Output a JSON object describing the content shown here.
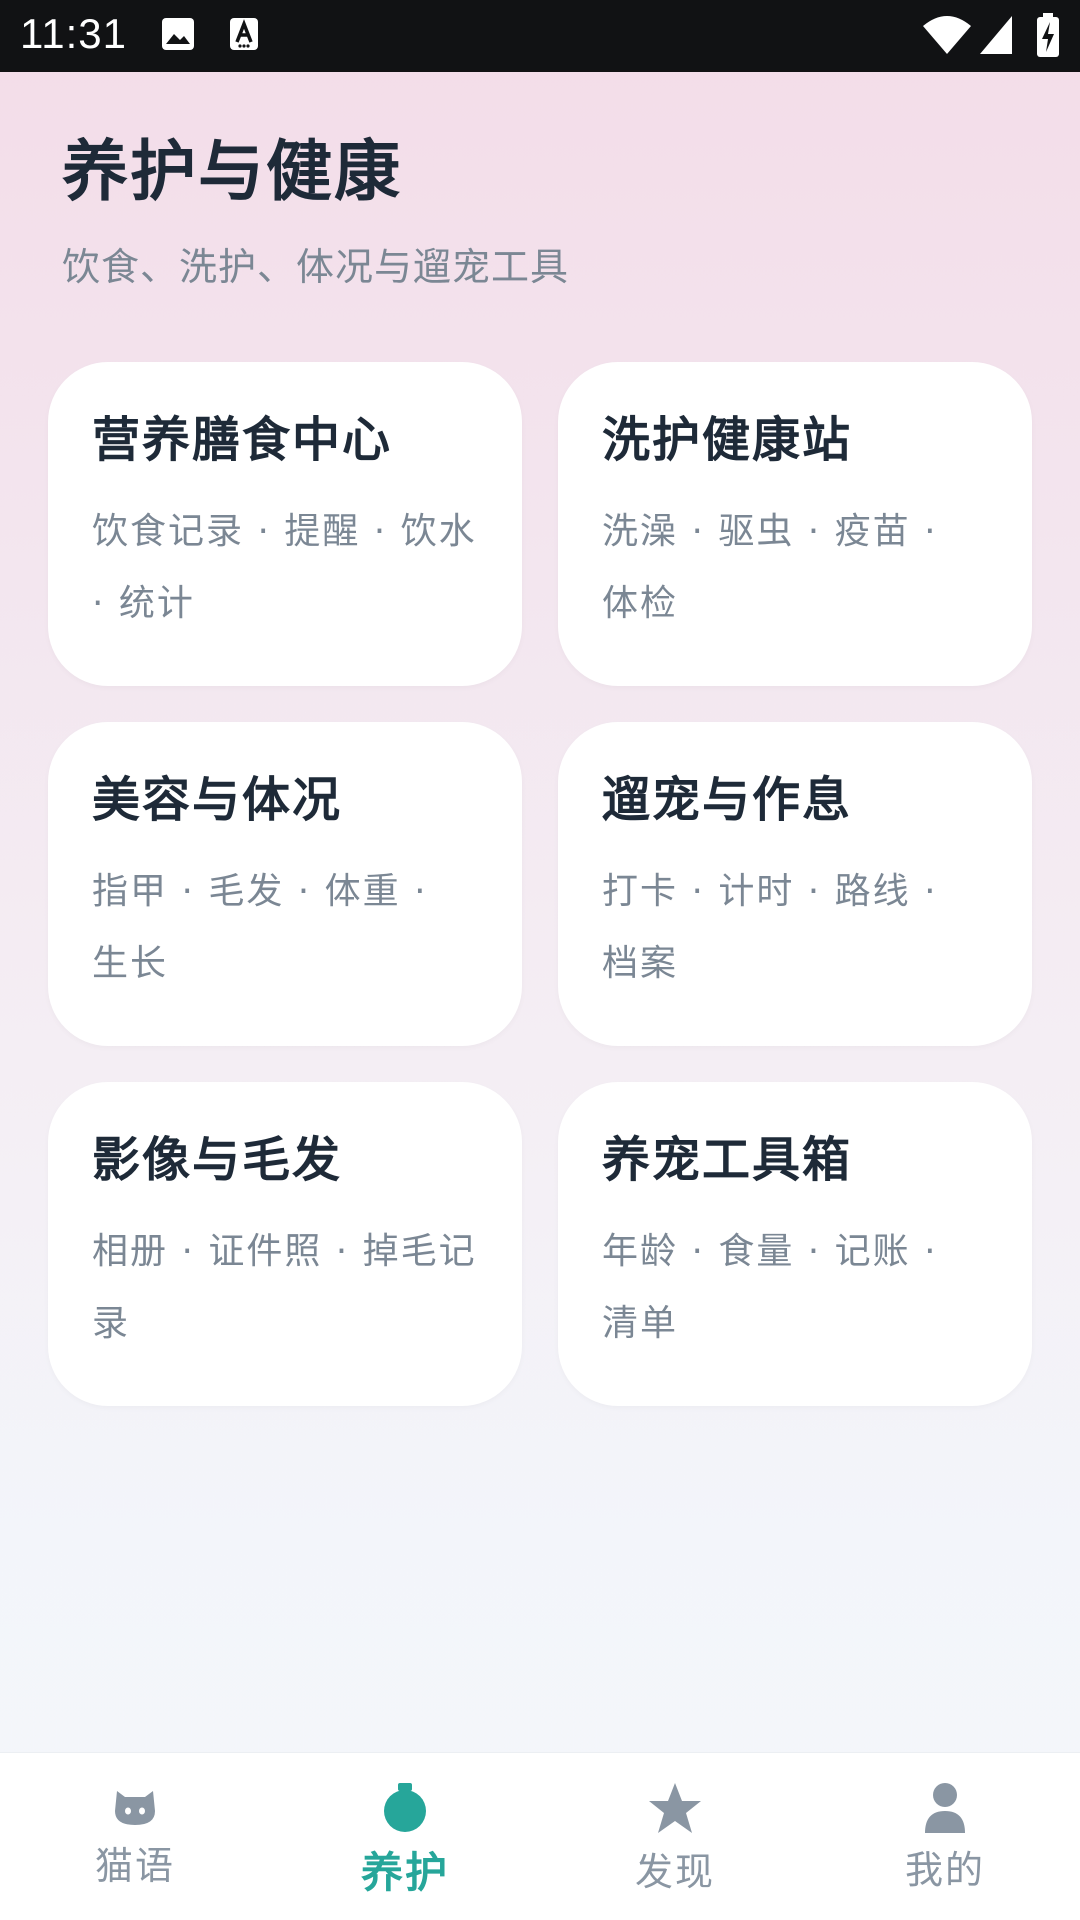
{
  "status_bar": {
    "time": "11:31",
    "icons": [
      "gallery-icon",
      "text-a-icon",
      "wifi-icon",
      "signal-icon",
      "battery-charging-icon"
    ]
  },
  "header": {
    "title": "养护与健康",
    "subtitle": "饮食、洗护、体况与遛宠工具"
  },
  "cards": [
    {
      "title": "营养膳食中心",
      "desc": "饮食记录 · 提醒 · 饮水 · 统计"
    },
    {
      "title": "洗护健康站",
      "desc": "洗澡 · 驱虫 · 疫苗 · 体检"
    },
    {
      "title": "美容与体况",
      "desc": "指甲 · 毛发 · 体重 · 生长"
    },
    {
      "title": "遛宠与作息",
      "desc": "打卡 · 计时 · 路线 · 档案"
    },
    {
      "title": "影像与毛发",
      "desc": "相册 · 证件照 · 掉毛记录"
    },
    {
      "title": "养宠工具箱",
      "desc": "年龄 · 食量 · 记账 · 清单"
    }
  ],
  "bottom_nav": {
    "items": [
      {
        "label": "猫语",
        "icon": "cat-face-icon",
        "active": false
      },
      {
        "label": "养护",
        "icon": "care-bottle-icon",
        "active": true
      },
      {
        "label": "发现",
        "icon": "star-icon",
        "active": false
      },
      {
        "label": "我的",
        "icon": "person-icon",
        "active": false
      }
    ]
  },
  "colors": {
    "accent": "#26a69a",
    "inactive_nav": "#8a96a3",
    "title_text": "#1e2a38",
    "secondary_text": "#7b8794",
    "status_bar_bg": "#111214"
  }
}
